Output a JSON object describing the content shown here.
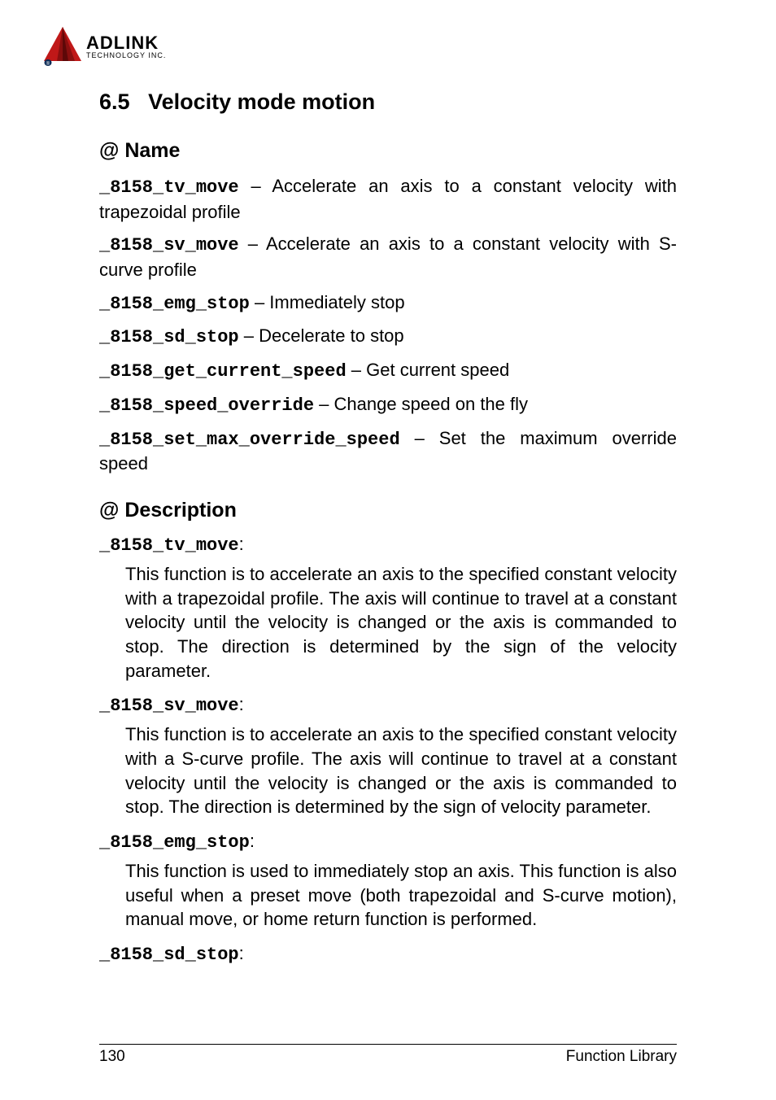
{
  "logo": {
    "brand": "ADLINK",
    "sub": "TECHNOLOGY INC."
  },
  "section": {
    "number": "6.5",
    "title": "Velocity mode motion"
  },
  "name_heading": "@ Name",
  "name_items": [
    {
      "fn": "_8158_tv_move",
      "desc": " – Accelerate an axis to a constant velocity with trapezoidal profile"
    },
    {
      "fn": "_8158_sv_move",
      "desc": " – Accelerate an axis to a constant velocity with S-curve profile"
    },
    {
      "fn": "_8158_emg_stop",
      "desc": " – Immediately stop"
    },
    {
      "fn": "_8158_sd_stop",
      "desc": " – Decelerate to stop"
    },
    {
      "fn": "_8158_get_current_speed",
      "desc": " – Get current speed"
    },
    {
      "fn": "_8158_speed_override",
      "desc": " – Change speed on the fly"
    },
    {
      "fn": "_8158_set_max_override_speed",
      "desc": " – Set the maximum override speed"
    }
  ],
  "desc_heading": "@ Description",
  "desc_items": [
    {
      "fn": "_8158_tv_move",
      "body": "This function is to accelerate an axis to the specified constant velocity with a trapezoidal profile. The axis will continue to travel at a constant velocity until the velocity is changed or the axis is commanded to stop. The direction is determined by the sign of the velocity parameter."
    },
    {
      "fn": "_8158_sv_move",
      "body": "This function is to accelerate an axis to the specified constant velocity with a S-curve profile. The axis will continue to travel at a constant velocity until the velocity is changed or the axis is commanded to stop. The direction is determined by the sign of velocity parameter."
    },
    {
      "fn": "_8158_emg_stop",
      "body": "This function is used to immediately stop an axis. This function is also useful when a preset move (both trapezoidal and S-curve motion), manual move, or home return function is performed."
    },
    {
      "fn": "_8158_sd_stop",
      "body": ""
    }
  ],
  "footer": {
    "page": "130",
    "label": "Function Library"
  }
}
